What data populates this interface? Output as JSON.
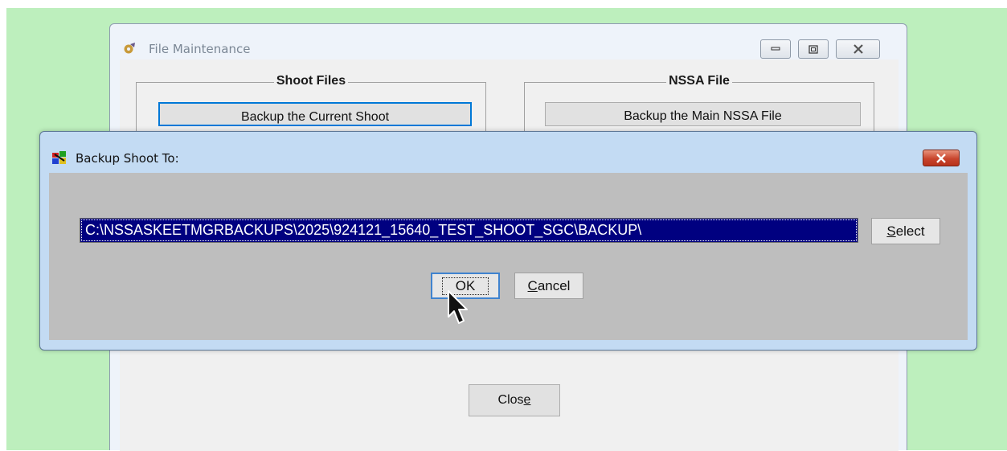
{
  "file_maintenance": {
    "title": "File Maintenance",
    "shoot_files": {
      "legend": "Shoot Files",
      "backup_button": "Backup the Current Shoot"
    },
    "nssa_file": {
      "legend": "NSSA File",
      "backup_button": "Backup the Main NSSA File"
    },
    "close_button": {
      "pre": "Clos",
      "accel": "e",
      "post": ""
    }
  },
  "backup_dialog": {
    "title": "Backup Shoot To:",
    "path_value": "C:\\NSSASKEETMGRBACKUPS\\2025\\924121_15640_TEST_SHOOT_SGC\\BACKUP\\",
    "select_button": {
      "accel": "S",
      "rest": "elect"
    },
    "ok_button": "OK",
    "cancel_button": {
      "accel": "C",
      "rest": "ancel"
    }
  },
  "icons": {
    "file_maintenance": "gear-icon",
    "backup_dialog": "app-icon",
    "cursor": "mouse-pointer-icon"
  },
  "colors": {
    "desktop": "#bdefbd",
    "selection": "#000080",
    "dialog_close": "#c8452d"
  }
}
